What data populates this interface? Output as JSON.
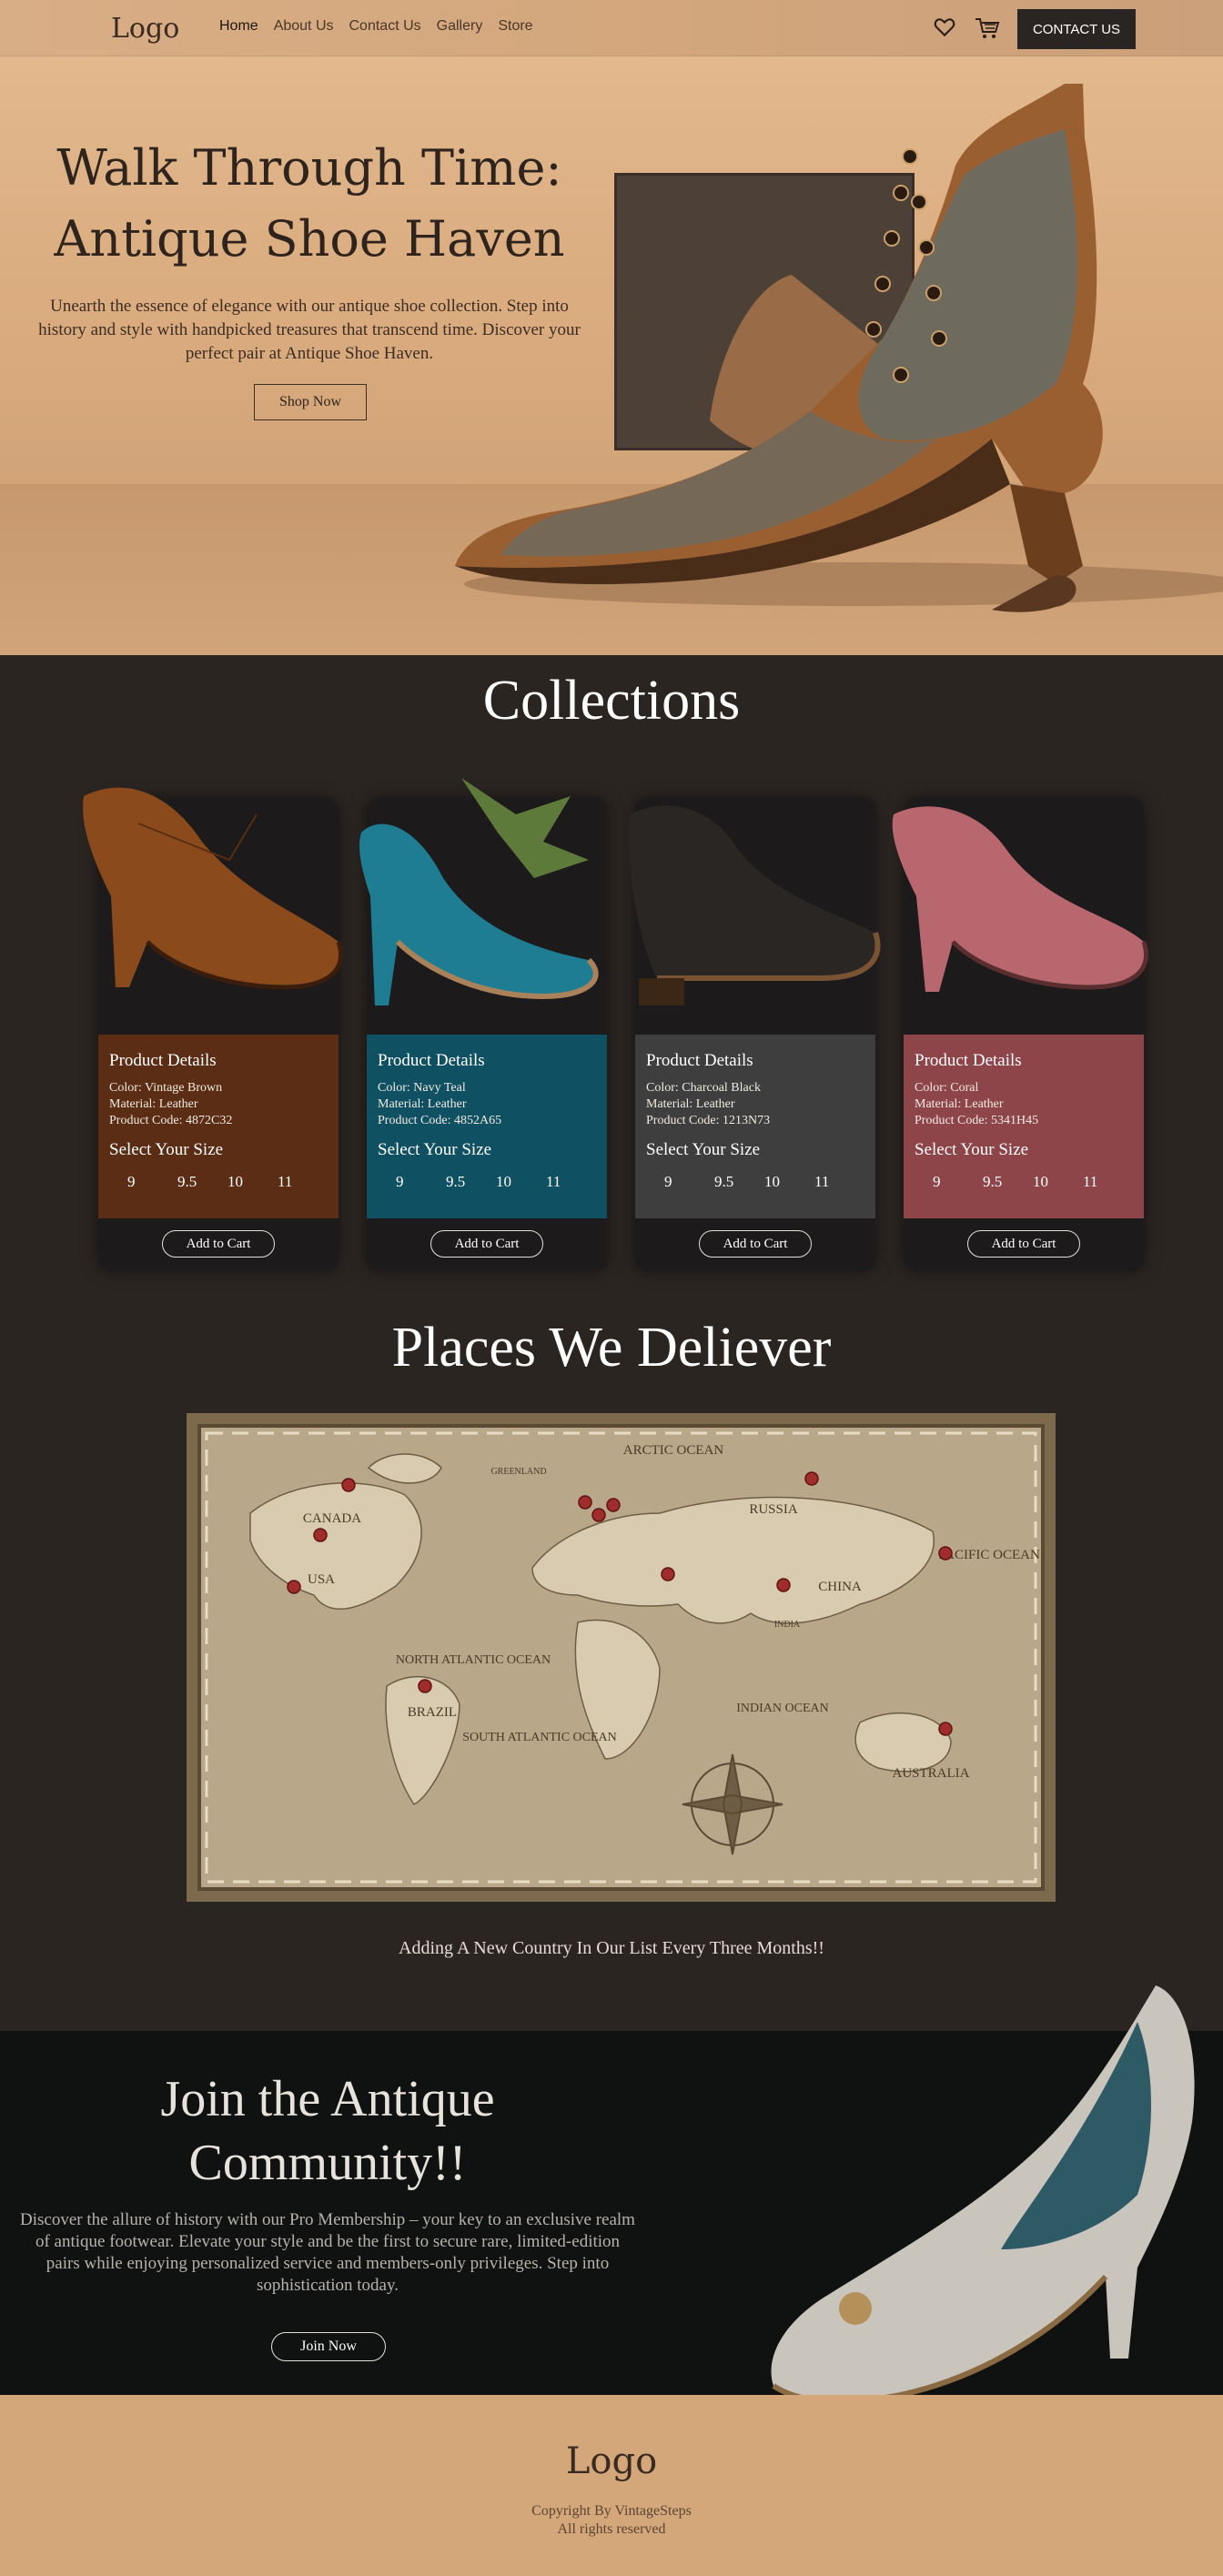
{
  "nav": {
    "logo": "Logo",
    "links": [
      "Home",
      "About Us",
      "Contact Us",
      "Gallery",
      "Store"
    ],
    "cta": "CONTACT US",
    "icons": [
      "heart-icon",
      "cart-icon"
    ]
  },
  "hero": {
    "title_line1": "Walk Through Time:",
    "title_line2": "Antique Shoe Haven",
    "description": "Unearth the essence of elegance with our antique shoe collection. Step into history and style with handpicked treasures that transcend time. Discover your perfect pair at Antique Shoe Haven.",
    "button": "Shop Now"
  },
  "collections": {
    "title": "Collections",
    "cards": [
      {
        "details_title": "Product Details",
        "color": "Color: Vintage Brown",
        "material": "Material: Leather",
        "code": "Product Code: 4872C32",
        "size_title": "Select Your Size",
        "sizes": [
          "9",
          "9.5",
          "10",
          "11"
        ],
        "button": "Add to Cart",
        "accent": "#5a2d14"
      },
      {
        "details_title": "Product Details",
        "color": "Color: Navy Teal",
        "material": "Material: Leather",
        "code": "Product Code: 4852A65",
        "size_title": "Select Your Size",
        "sizes": [
          "9",
          "9.5",
          "10",
          "11"
        ],
        "button": "Add to Cart",
        "accent": "#0f5062"
      },
      {
        "details_title": "Product Details",
        "color": "Color: Charcoal Black",
        "material": "Material: Leather",
        "code": "Product Code: 1213N73",
        "size_title": "Select Your Size",
        "sizes": [
          "9",
          "9.5",
          "10",
          "11"
        ],
        "button": "Add to Cart",
        "accent": "#3e3e3e"
      },
      {
        "details_title": "Product Details",
        "color": "Color: Coral",
        "material": "Material: Leather",
        "code": "Product Code: 5341H45",
        "size_title": "Select Your Size",
        "sizes": [
          "9",
          "9.5",
          "10",
          "11"
        ],
        "button": "Add to Cart",
        "accent": "#8e454a"
      }
    ]
  },
  "places": {
    "title": "Places We Deliever",
    "map_labels": [
      "ARCTIC OCEAN",
      "GREENLAND",
      "CANADA",
      "USA",
      "RUSSIA",
      "CHINA",
      "PACIFIC OCEAN",
      "NORTH ATLANTIC OCEAN",
      "BRAZIL",
      "SOUTH ATLANTIC OCEAN",
      "INDIAN OCEAN",
      "AUSTRALIA",
      "INDIA"
    ],
    "note": "Adding A New Country In Our List Every Three Months!!"
  },
  "community": {
    "title_line1": "Join the Antique",
    "title_line2": "Community!!",
    "description": "Discover the allure of history with our Pro Membership – your key to an exclusive realm of antique footwear. Elevate your style and be the first to secure rare, limited-edition pairs while enjoying personalized service and members-only privileges. Step into sophistication today.",
    "button": "Join Now"
  },
  "footer": {
    "logo": "Logo",
    "copyright": "Copyright By VintageSteps",
    "rights": "All rights reserved"
  }
}
